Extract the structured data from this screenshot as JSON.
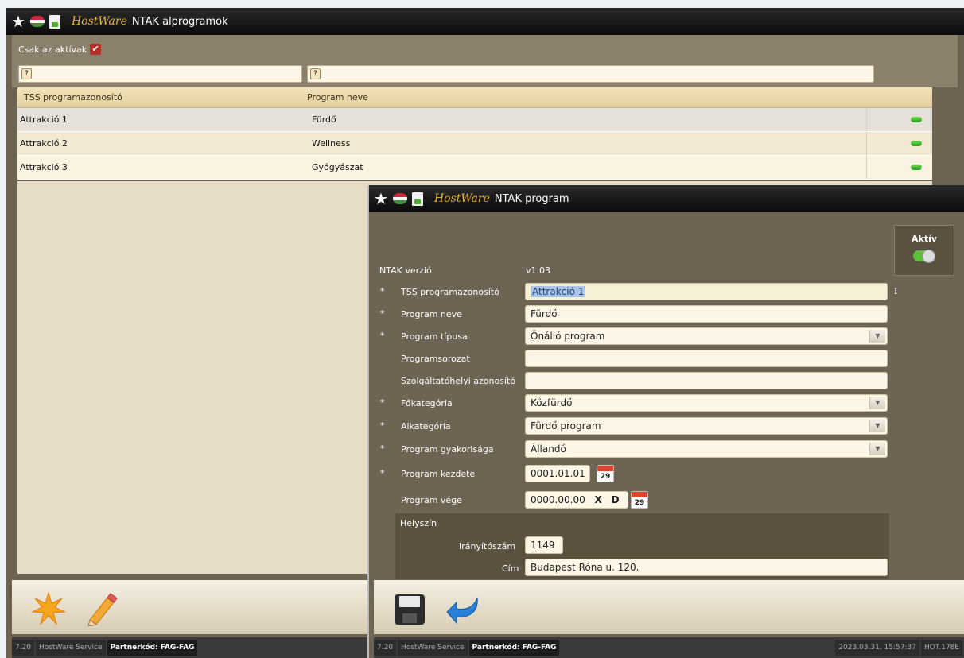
{
  "main_window": {
    "brand": "HostWare",
    "title": "NTAK alprogramok",
    "filter_label": "Csak az aktívak",
    "filter_checked": true,
    "search1_placeholder": "?",
    "search2_placeholder": "?",
    "columns": [
      "TSS programazonosító",
      "Program neve"
    ],
    "rows": [
      {
        "id": "Attrakció 1",
        "name": "Fürdő",
        "active": true
      },
      {
        "id": "Attrakció 2",
        "name": "Wellness",
        "active": true
      },
      {
        "id": "Attrakció 3",
        "name": "Gyógyászat",
        "active": true
      }
    ],
    "status": {
      "version": "7.20",
      "service": "HostWare Service",
      "partner": "Partnerkód: FAG-FAG"
    }
  },
  "dialog": {
    "brand": "HostWare",
    "title": "NTAK program",
    "aktiv_label": "Aktív",
    "aktiv_on": true,
    "ntak_version_label": "NTAK verzió",
    "ntak_version_value": "v1.03",
    "fields": {
      "tss_label": "TSS programazonosító",
      "tss_value": "Attrakció 1",
      "name_label": "Program neve",
      "name_value": "Fürdő",
      "type_label": "Program típusa",
      "type_value": "Önálló program",
      "series_label": "Programsorozat",
      "series_value": "",
      "provider_label": "Szolgáltatóhelyi azonosító",
      "provider_value": "",
      "maincat_label": "Főkategória",
      "maincat_value": "Közfürdő",
      "subcat_label": "Alkategória",
      "subcat_value": "Fürdő program",
      "freq_label": "Program gyakorisága",
      "freq_value": "Állandó",
      "start_label": "Program kezdete",
      "start_value": "0001.01.01",
      "end_label": "Program vége",
      "end_value": "0000.00.00",
      "end_x": "X",
      "end_d": "D"
    },
    "location": {
      "section_label": "Helyszín",
      "zip_label": "Irányítószám",
      "zip_value": "1149",
      "addr_label": "Cím",
      "addr_value": "Budapest Róna u. 120."
    },
    "required_mark": "*",
    "cursor_mark": "I",
    "calendar_day": "29",
    "status": {
      "version": "7.20",
      "service": "HostWare Service",
      "partner": "Partnerkód: FAG-FAG",
      "datetime": "2023.03.31. 15:57:37",
      "code": "HOT.178E"
    }
  }
}
